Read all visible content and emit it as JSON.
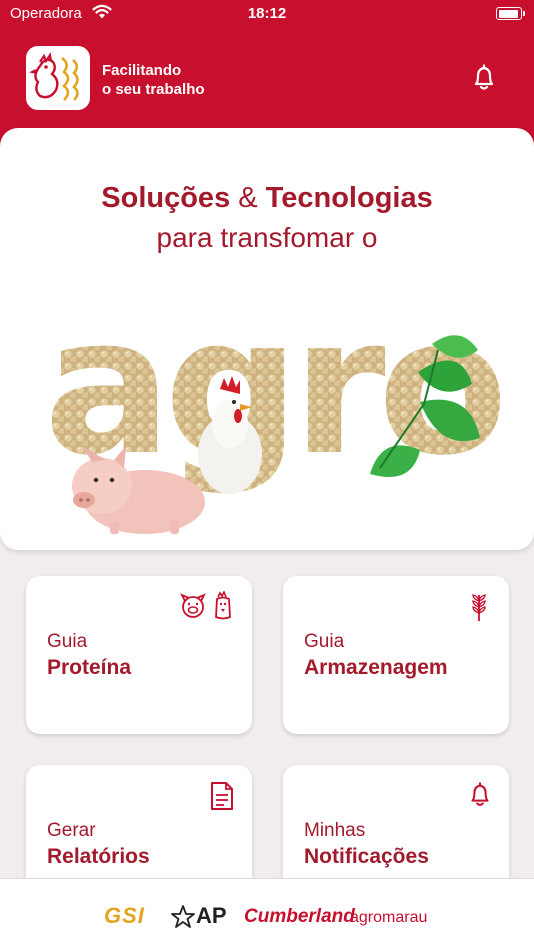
{
  "status": {
    "carrier": "Operadora",
    "time": "18:12"
  },
  "header": {
    "tagline_line1": "Facilitando",
    "tagline_line2": "o seu trabalho",
    "bell_icon": "bell-icon"
  },
  "hero": {
    "title_word1": "Soluções",
    "title_amp": "&",
    "title_word2": "Tecnologias",
    "subtitle": "para transfomar o",
    "art_word": "agro"
  },
  "cards": [
    {
      "line1": "Guia",
      "line2": "Proteína",
      "icons": [
        "pig-icon",
        "chicken-icon"
      ]
    },
    {
      "line1": "Guia",
      "line2": "Armazenagem",
      "icons": [
        "wheat-icon"
      ]
    },
    {
      "line1": "Gerar",
      "line2": "Relatórios",
      "icons": [
        "document-icon"
      ]
    },
    {
      "line1": "Minhas",
      "line2": "Notificações",
      "icons": [
        "bell-icon"
      ]
    }
  ],
  "partners": [
    "GSI",
    "AP",
    "Cumberland",
    "agromarau"
  ],
  "colors": {
    "brand_red": "#c8102e",
    "text_red": "#a31a2c",
    "background": "#f1eded",
    "grain": "#d8c39a"
  }
}
